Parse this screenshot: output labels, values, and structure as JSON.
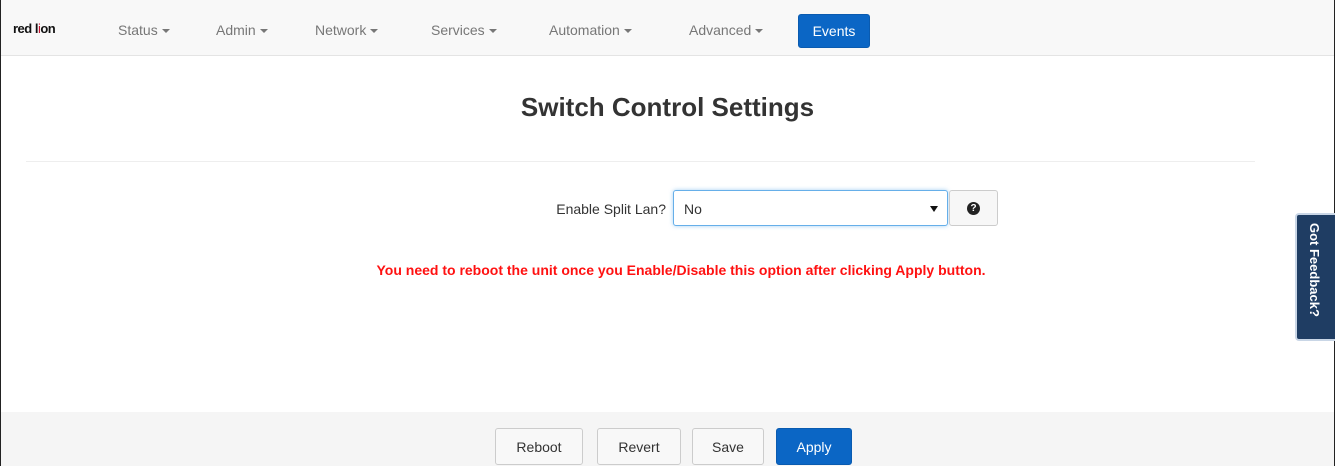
{
  "brand": {
    "logo_text": "red lion"
  },
  "nav": {
    "items": [
      "Status",
      "Admin",
      "Network",
      "Services",
      "Automation",
      "Advanced"
    ],
    "active": "Events"
  },
  "page": {
    "title": "Switch Control Settings"
  },
  "form": {
    "split_lan_label": "Enable Split Lan?",
    "split_lan_value": "No",
    "warning": "You need to reboot the unit once you Enable/Disable this option after clicking Apply button."
  },
  "feedback": {
    "label": "Got Feedback?"
  },
  "footer": {
    "reboot": "Reboot",
    "revert": "Revert",
    "save": "Save",
    "apply": "Apply"
  },
  "colors": {
    "primary": "#0b66c5",
    "warning": "#ff1111",
    "feedback_bg": "#1f3d63"
  }
}
